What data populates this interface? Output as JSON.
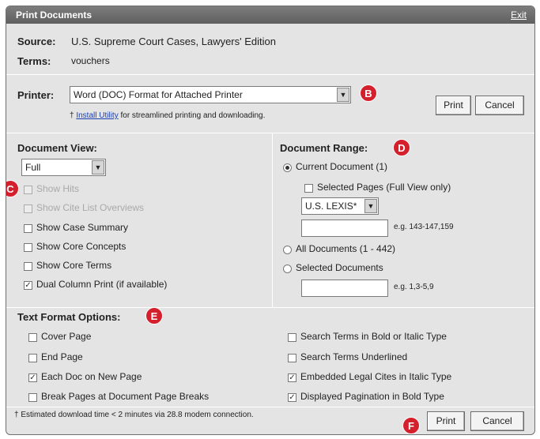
{
  "window": {
    "title": "Print Documents",
    "close_label": "Exit"
  },
  "header": {
    "source_label": "Source:",
    "source_value": "U.S. Supreme Court Cases, Lawyers' Edition",
    "terms_label": "Terms:",
    "terms_value": "vouchers"
  },
  "printer": {
    "label": "Printer:",
    "selected": "Word (DOC) Format for Attached Printer",
    "note_prefix": "†",
    "install_link": "Install Utility",
    "note_suffix": "for streamlined printing and downloading.",
    "print_label": "Print",
    "cancel_label": "Cancel"
  },
  "document_view": {
    "heading": "Document View:",
    "selected": "Full",
    "options": [
      {
        "label": "Show Hits",
        "checked": false,
        "disabled": true
      },
      {
        "label": "Show Cite List Overviews",
        "checked": false,
        "disabled": true
      },
      {
        "label": "Show Case Summary",
        "checked": false,
        "disabled": false
      },
      {
        "label": "Show Core Concepts",
        "checked": false,
        "disabled": false
      },
      {
        "label": "Show Core Terms",
        "checked": false,
        "disabled": false
      },
      {
        "label": "Dual Column Print (if available)",
        "checked": true,
        "disabled": false
      }
    ]
  },
  "document_range": {
    "heading": "Document Range:",
    "current": "Current Document (1)",
    "selected_pages": "Selected Pages (Full View only)",
    "view_select": "U.S. LEXIS*",
    "pages_example": "e.g. 143-147,159",
    "all_docs": "All Documents (1 - 442)",
    "selected_docs": "Selected Documents",
    "docs_example": "e.g. 1,3-5,9"
  },
  "text_format": {
    "heading": "Text Format Options:",
    "left": [
      {
        "label": "Cover Page",
        "checked": false
      },
      {
        "label": "End Page",
        "checked": false
      },
      {
        "label": "Each Doc on New Page",
        "checked": true
      },
      {
        "label": "Break Pages at Document Page Breaks",
        "checked": false
      }
    ],
    "right": [
      {
        "label": "Search Terms in Bold or Italic Type",
        "checked": false
      },
      {
        "label": "Search Terms Underlined",
        "checked": false
      },
      {
        "label": "Embedded Legal Cites in Italic Type",
        "checked": true
      },
      {
        "label": "Displayed Pagination in Bold Type",
        "checked": true
      }
    ]
  },
  "footer": {
    "note": "† Estimated download time < 2 minutes via 28.8 modem connection.",
    "print_label": "Print",
    "cancel_label": "Cancel"
  },
  "markers": {
    "b": "B",
    "c": "C",
    "d": "D",
    "e": "E",
    "f": "F"
  },
  "colors": {
    "marker": "#d4202c",
    "titlebar": "#6e6e6e",
    "panel": "#e4e4e4"
  }
}
